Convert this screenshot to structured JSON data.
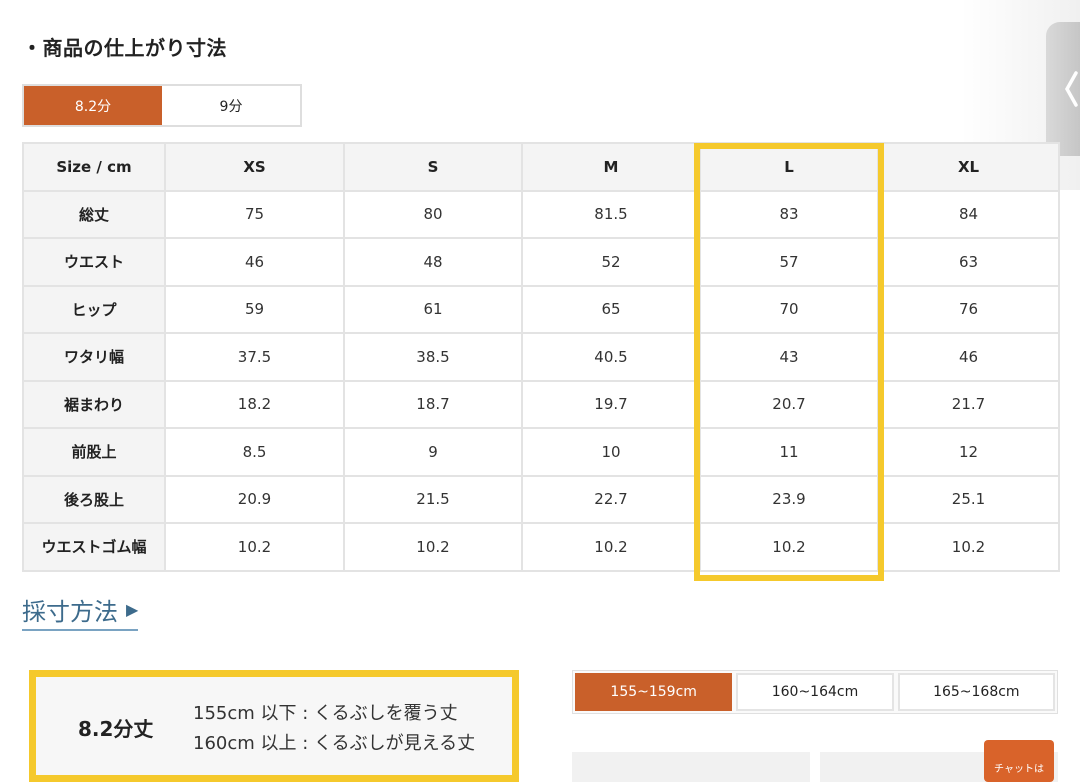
{
  "title": "・商品の仕上がり寸法",
  "length_tabs": [
    {
      "label": "8.2分",
      "active": true
    },
    {
      "label": "9分",
      "active": false
    }
  ],
  "table": {
    "corner": "Size / cm",
    "sizes": [
      "XS",
      "S",
      "M",
      "L",
      "XL"
    ],
    "rows": [
      {
        "label": "総丈",
        "values": [
          "75",
          "80",
          "81.5",
          "83",
          "84"
        ]
      },
      {
        "label": "ウエスト",
        "values": [
          "46",
          "48",
          "52",
          "57",
          "63"
        ]
      },
      {
        "label": "ヒップ",
        "values": [
          "59",
          "61",
          "65",
          "70",
          "76"
        ]
      },
      {
        "label": "ワタリ幅",
        "values": [
          "37.5",
          "38.5",
          "40.5",
          "43",
          "46"
        ]
      },
      {
        "label": "裾まわり",
        "values": [
          "18.2",
          "18.7",
          "19.7",
          "20.7",
          "21.7"
        ]
      },
      {
        "label": "前股上",
        "values": [
          "8.5",
          "9",
          "10",
          "11",
          "12"
        ]
      },
      {
        "label": "後ろ股上",
        "values": [
          "20.9",
          "21.5",
          "22.7",
          "23.9",
          "25.1"
        ]
      },
      {
        "label": "ウエストゴム幅",
        "values": [
          "10.2",
          "10.2",
          "10.2",
          "10.2",
          "10.2"
        ]
      }
    ]
  },
  "measure_link": {
    "label": "採寸方法",
    "arrow": "▶"
  },
  "note": {
    "title": "8.2分丈",
    "line1": "155cm 以下 : くるぶしを覆う丈",
    "line2": "160cm 以上 : くるぶしが見える丈"
  },
  "height_tabs": [
    {
      "label": "155~159cm",
      "active": true
    },
    {
      "label": "160~164cm",
      "active": false
    },
    {
      "label": "165~168cm",
      "active": false
    }
  ],
  "chat_button": {
    "label": "チャットは"
  },
  "colors": {
    "accent": "#c9602a",
    "highlight": "#f5c92c",
    "link": "#3d6b8c"
  }
}
